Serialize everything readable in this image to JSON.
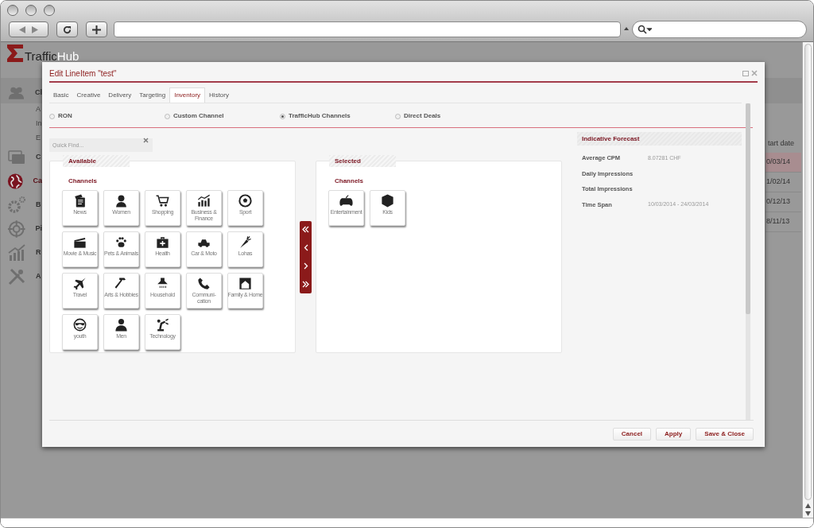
{
  "app": {
    "logo": {
      "brand": "Traffic",
      "brand_suffix": "Hub"
    },
    "sidebar": {
      "items": [
        {
          "label": "Cl",
          "selected": false,
          "children": [
            {
              "label": "A",
              "selected": false
            },
            {
              "label": "In",
              "selected": false
            },
            {
              "label": "E",
              "selected": false
            }
          ]
        },
        {
          "label": "C",
          "selected": false
        },
        {
          "label": "Ca",
          "selected": true
        },
        {
          "label": "B",
          "selected": false
        },
        {
          "label": "Pi",
          "selected": false
        },
        {
          "label": "R",
          "selected": false
        },
        {
          "label": "A",
          "selected": false
        }
      ]
    },
    "table": {
      "columns": [
        "tart date"
      ],
      "rows": [
        {
          "cells": [
            "0/03/14"
          ],
          "selected": true
        },
        {
          "cells": [
            "1/02/14"
          ],
          "selected": false
        },
        {
          "cells": [
            "0/12/13"
          ],
          "selected": false
        },
        {
          "cells": [
            "8/11/13"
          ],
          "selected": false
        }
      ]
    }
  },
  "dialog": {
    "title": "Edit LineItem \"test\"",
    "tabs": [
      {
        "label": "Basic",
        "selected": false
      },
      {
        "label": "Creative",
        "selected": false
      },
      {
        "label": "Delivery",
        "selected": false
      },
      {
        "label": "Targeting",
        "selected": false
      },
      {
        "label": "Inventory",
        "selected": true
      },
      {
        "label": "History",
        "selected": false
      }
    ],
    "inventory_source": [
      {
        "label": "RON",
        "selected": false
      },
      {
        "label": "Custom Channel",
        "selected": false
      },
      {
        "label": "TrafficHub Channels",
        "selected": true
      },
      {
        "label": "Direct Deals",
        "selected": false
      }
    ],
    "quick_find": {
      "placeholder": "Quick Find..."
    },
    "available": {
      "title": "Available",
      "group": "Channels",
      "channels": [
        {
          "label": "News"
        },
        {
          "label": "Women"
        },
        {
          "label": "Shopping"
        },
        {
          "label": "Business & Finance"
        },
        {
          "label": "Sport"
        },
        {
          "label": "Movie & Music"
        },
        {
          "label": "Pets & Animals"
        },
        {
          "label": "Health"
        },
        {
          "label": "Car & Moto"
        },
        {
          "label": "Lohas"
        },
        {
          "label": "Travel"
        },
        {
          "label": "Arts & Hobbies"
        },
        {
          "label": "Household"
        },
        {
          "label": "Communi-cation"
        },
        {
          "label": "Family & Home"
        },
        {
          "label": "youth"
        },
        {
          "label": "Men"
        },
        {
          "label": "Technology"
        }
      ]
    },
    "selected": {
      "title": "Selected",
      "group": "Channels",
      "channels": [
        {
          "label": "Entertainment"
        },
        {
          "label": "Kids"
        }
      ]
    },
    "forecast": {
      "title": "Indicative Forecast",
      "rows": [
        {
          "label": "Average CPM",
          "value": "8.07281 CHF"
        },
        {
          "label": "Daily Impressions"
        },
        {
          "label": "Total Impressions"
        },
        {
          "label": "Time Span",
          "value": "10/03/2014 - 24/03/2014"
        }
      ]
    },
    "buttons": [
      "Cancel",
      "Apply",
      "Save & Close"
    ]
  }
}
